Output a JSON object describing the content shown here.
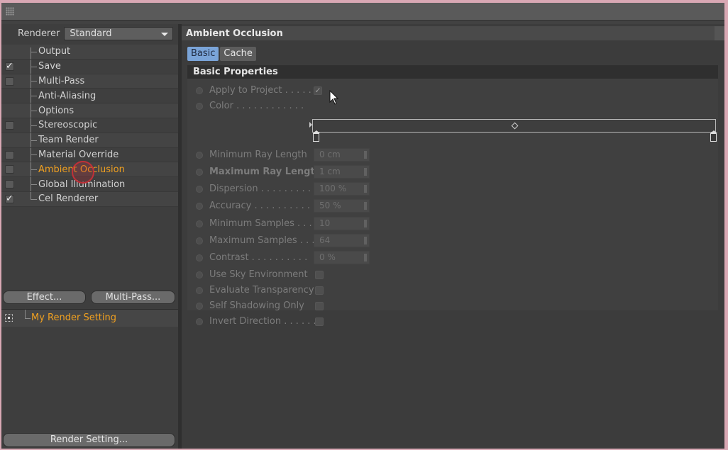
{
  "left": {
    "renderer_label": "Renderer",
    "renderer_value": "Standard",
    "tree": [
      {
        "label": "Output",
        "check": "none"
      },
      {
        "label": "Save",
        "check": "checked"
      },
      {
        "label": "Multi-Pass",
        "check": "empty"
      },
      {
        "label": "Anti-Aliasing",
        "check": "none"
      },
      {
        "label": "Options",
        "check": "none"
      },
      {
        "label": "Stereoscopic",
        "check": "empty"
      },
      {
        "label": "Team Render",
        "check": "none"
      },
      {
        "label": "Material Override",
        "check": "empty"
      },
      {
        "label": "Ambient Occlusion",
        "check": "empty",
        "active": true
      },
      {
        "label": "Global Illumination",
        "check": "empty"
      },
      {
        "label": "Cel Renderer",
        "check": "checked"
      }
    ],
    "effect_button": "Effect...",
    "multipass_button": "Multi-Pass...",
    "render_setting_name": "My Render Setting",
    "render_setting_button": "Render Setting..."
  },
  "right": {
    "header": "Ambient Occlusion",
    "tabs": [
      "Basic",
      "Cache"
    ],
    "section": "Basic Properties",
    "props": {
      "apply_to_project": "Apply to Project . . . . .",
      "color": "Color . . . . . . . . . . . .",
      "min_ray": "Minimum Ray Length",
      "min_ray_value": "0 cm",
      "max_ray": "Maximum Ray Length",
      "max_ray_value": "1 cm",
      "dispersion": "Dispersion . . . . . . . . .",
      "dispersion_value": "100 %",
      "accuracy": "Accuracy . . . . . . . . . .",
      "accuracy_value": "50 %",
      "min_samples": "Minimum Samples . . .",
      "min_samples_value": "10",
      "max_samples": "Maximum Samples . . .",
      "max_samples_value": "64",
      "contrast": "Contrast . . . . . . . . . .",
      "contrast_value": "0 %",
      "use_sky": "Use Sky Environment",
      "eval_transparency": "Evaluate Transparency",
      "self_shadowing": "Self Shadowing Only",
      "invert_direction": "Invert Direction . . . . . ."
    }
  },
  "icons": {
    "check": "✓"
  }
}
